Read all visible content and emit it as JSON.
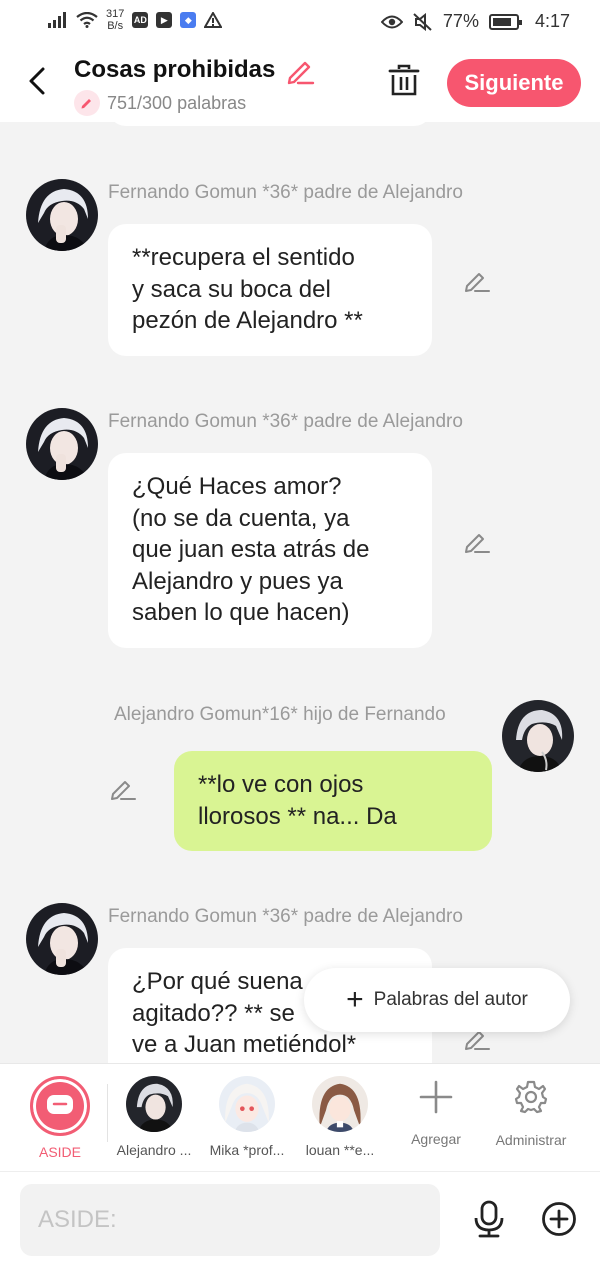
{
  "status_bar": {
    "net_speed_value": "317",
    "net_speed_unit": "B/s",
    "battery": "77%",
    "time": "4:17"
  },
  "header": {
    "title": "Cosas prohibidas",
    "word_count": "751/300 palabras",
    "next_label": "Siguiente"
  },
  "messages": [
    {
      "sender": "Fernando Gomun  *36* padre de Alejandro",
      "lines": [
        "**recupera el sentido",
        "y saca su boca del",
        "pezón de Alejandro **"
      ]
    },
    {
      "sender": "Fernando Gomun  *36* padre de Alejandro",
      "lines": [
        "¿Qué Haces amor?",
        "(no se da cuenta, ya",
        "que juan esta atrás de",
        "Alejandro y pues ya",
        "saben lo que hacen)"
      ]
    },
    {
      "sender": "Alejandro Gomun*16* hijo de Fernando",
      "lines": [
        "**lo ve con ojos",
        "llorosos ** na... Da"
      ]
    },
    {
      "sender": "Fernando Gomun  *36* padre de Alejandro",
      "lines": [
        "¿Por qué suena",
        "agitado?? ** se",
        "ve a Juan metiéndol*"
      ]
    }
  ],
  "fab": {
    "label": "Palabras del autor"
  },
  "characters": [
    {
      "label": "ASIDE",
      "icon": "chat-bubble-icon"
    },
    {
      "label": "Alejandro ..."
    },
    {
      "label": "Mika *prof..."
    },
    {
      "label": "louan **e..."
    }
  ],
  "tools": {
    "add_label": "Agregar",
    "manage_label": "Administrar"
  },
  "input": {
    "placeholder": "ASIDE:"
  },
  "colors": {
    "accent": "#f7566f",
    "bubble_own": "#d9f493",
    "chat_background": "#f3f3f3"
  }
}
